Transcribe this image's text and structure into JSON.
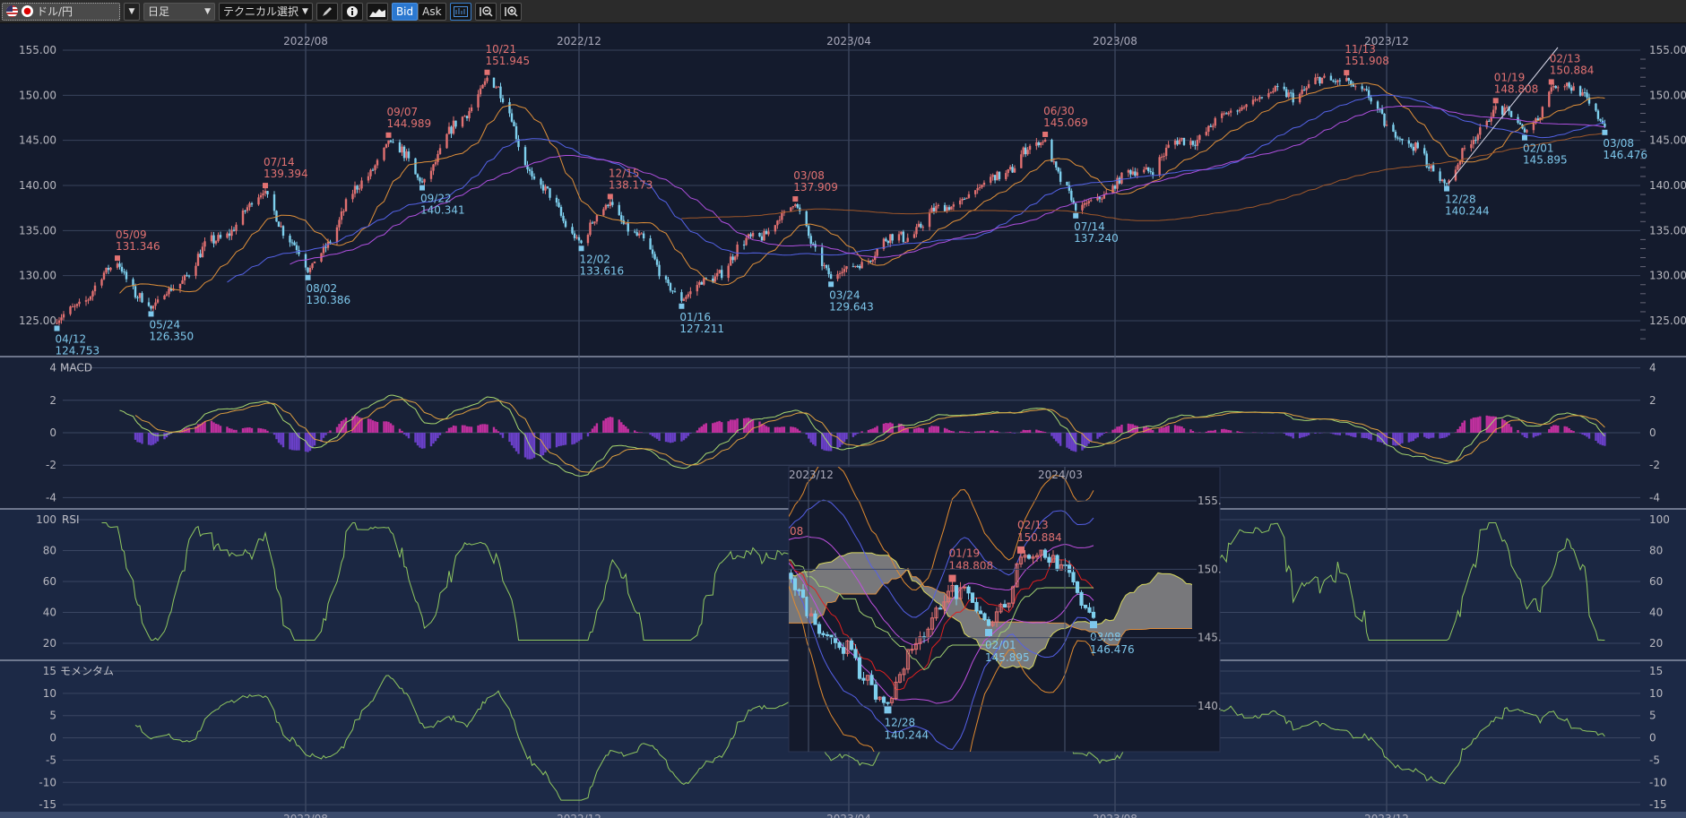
{
  "toolbar": {
    "pair_label": "ドル/円",
    "timeframe_label": "日足",
    "technical_label": "テクニカル選択",
    "bid_label": "Bid",
    "ask_label": "Ask",
    "dropdown_glyph": "▼",
    "icons": [
      "us-flag-icon",
      "jp-flag-icon",
      "pencil-icon",
      "info-icon",
      "mountain-chart-icon",
      "indicator-icon",
      "zoom-out-icon",
      "zoom-in-icon"
    ]
  },
  "colors": {
    "up_candle": "#e07070",
    "down_candle": "#7ed0ee",
    "high_label": "#e27272",
    "low_label": "#7ec8ec",
    "ma_short": "#e0903a",
    "ma_mid": "#5563e8",
    "ma_long": "#b050e0",
    "ma_200": "#a0582a",
    "macd": "#a8d870",
    "signal": "#e0a040",
    "hist_pos": "#c0309e",
    "hist_neg": "#6a40c8",
    "rsi": "#90c860",
    "momentum": "#90c860"
  },
  "chart_data": {
    "type": "candlestick",
    "symbol": "ドル/円",
    "timeframe": "日足",
    "x_ticks": [
      {
        "label": "2022/08",
        "date": "2022-08-01"
      },
      {
        "label": "2022/12",
        "date": "2022-12-01"
      },
      {
        "label": "2023/04",
        "date": "2023-04-01"
      },
      {
        "label": "2023/08",
        "date": "2023-08-01"
      },
      {
        "label": "2023/12",
        "date": "2023-12-01"
      }
    ],
    "price_axis": {
      "ticks": [
        "155.00",
        "150.00",
        "145.00",
        "140.00",
        "135.00",
        "130.00",
        "125.00"
      ],
      "ylim": [
        123.5,
        156.5
      ]
    },
    "annotations": [
      {
        "date": "2022-04-12",
        "label": "04/12",
        "value": "124.753",
        "kind": "low"
      },
      {
        "date": "2022-05-09",
        "label": "05/09",
        "value": "131.346",
        "kind": "high"
      },
      {
        "date": "2022-05-24",
        "label": "05/24",
        "value": "126.350",
        "kind": "low"
      },
      {
        "date": "2022-07-14",
        "label": "07/14",
        "value": "139.394",
        "kind": "high"
      },
      {
        "date": "2022-08-02",
        "label": "08/02",
        "value": "130.386",
        "kind": "low"
      },
      {
        "date": "2022-09-07",
        "label": "09/07",
        "value": "144.989",
        "kind": "high"
      },
      {
        "date": "2022-09-22",
        "label": "09/22",
        "value": "140.341",
        "kind": "low"
      },
      {
        "date": "2022-10-21",
        "label": "10/21",
        "value": "151.945",
        "kind": "high"
      },
      {
        "date": "2022-12-02",
        "label": "12/02",
        "value": "133.616",
        "kind": "low"
      },
      {
        "date": "2022-12-15",
        "label": "12/15",
        "value": "138.173",
        "kind": "high"
      },
      {
        "date": "2023-01-16",
        "label": "01/16",
        "value": "127.211",
        "kind": "low"
      },
      {
        "date": "2023-03-08",
        "label": "03/08",
        "value": "137.909",
        "kind": "high"
      },
      {
        "date": "2023-03-24",
        "label": "03/24",
        "value": "129.643",
        "kind": "low"
      },
      {
        "date": "2023-06-30",
        "label": "06/30",
        "value": "145.069",
        "kind": "high"
      },
      {
        "date": "2023-07-14",
        "label": "07/14",
        "value": "137.240",
        "kind": "low"
      },
      {
        "date": "2023-11-13",
        "label": "11/13",
        "value": "151.908",
        "kind": "high"
      },
      {
        "date": "2023-12-28",
        "label": "12/28",
        "value": "140.244",
        "kind": "low"
      },
      {
        "date": "2024-01-19",
        "label": "01/19",
        "value": "148.808",
        "kind": "high"
      },
      {
        "date": "2024-02-01",
        "label": "02/01",
        "value": "145.895",
        "kind": "low"
      },
      {
        "date": "2024-02-13",
        "label": "02/13",
        "value": "150.884",
        "kind": "high"
      },
      {
        "date": "2024-03-08",
        "label": "03/08",
        "value": "146.476",
        "kind": "low"
      }
    ],
    "price_path": [
      {
        "date": "2022-10-31",
        "value": 148.0
      },
      {
        "date": "2022-11-10",
        "value": 141.0
      },
      {
        "date": "2023-05-31",
        "value": 139.8
      },
      {
        "date": "2023-10-02",
        "value": 149.5
      },
      {
        "date": "2023-12-08",
        "value": 145.0
      },
      {
        "date": "2024-02-28",
        "value": 150.3
      }
    ],
    "panels": [
      {
        "name": "MACD",
        "ticks": [
          "4",
          "2",
          "0",
          "-2",
          "-4"
        ],
        "ylim": [
          -4,
          4
        ]
      },
      {
        "name": "RSI",
        "ticks": [
          "100",
          "80",
          "60",
          "40",
          "20"
        ],
        "ylim": [
          20,
          100
        ]
      },
      {
        "name": "モメンタム",
        "ticks": [
          "15",
          "10",
          "5",
          "0",
          "-5",
          "-10",
          "-15"
        ],
        "ylim": [
          -15,
          15
        ]
      }
    ],
    "inset": {
      "x_ticks": [
        "2023/12",
        "2024/03"
      ],
      "price_ticks": [
        "155.",
        "150.",
        "145.",
        "140."
      ],
      "annotations": [
        {
          "label": "12/28",
          "value": "140.244",
          "kind": "low"
        },
        {
          "label": "01/19",
          "value": "148.808",
          "kind": "high"
        },
        {
          "label": "02/01",
          "value": "145.895",
          "kind": "low"
        },
        {
          "label": "02/13",
          "value": "150.884",
          "kind": "high"
        },
        {
          "label": "03/08",
          "value": "146.476",
          "kind": "low"
        }
      ],
      "partial_label": "08"
    }
  }
}
